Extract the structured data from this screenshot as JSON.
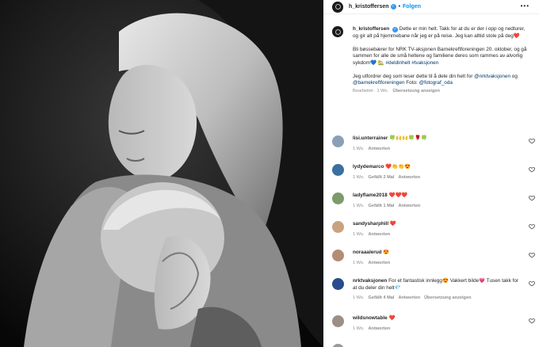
{
  "post": {
    "username": "h_kristoffersen",
    "dot": "•",
    "follow_label": "Folgen",
    "more_icon": "more-horizontal-icon"
  },
  "caption": {
    "username": "h_kristoffersen",
    "p1": "Dette er min helt. Takk for at du er der i opp og nedturer, og gir alt på hjemmebane når jeg er på reise. Jeg kan alltid stole på deg❤️",
    "p2_text": "Bli bøssebærer for NRK TV-aksjonen Barnekreftforeningen 20. oktober, og gå sammen for alle de små heltene og familiene deres som rammes av alvorlig sykdom💙 🏡 ",
    "p2_tag1": "#deldinhelt",
    "p2_tag2": "#tvaksjonen",
    "p3_text": "Jeg utfordrer deg som leser dette til å dele din helt for ",
    "p3_mention1": "@nrktvaksjonen",
    "p3_og": " og ",
    "p3_mention2": "@barnekreftforeningen",
    "p3_foto": " Foto: ",
    "p3_mention3": "@fotograf_oda",
    "meta_edited": "Bearbeitet · 1 Wo.",
    "meta_translation": "Übersetzung anzeigen"
  },
  "comments": [
    {
      "username": "lisi.unterrainer",
      "text": "🍀🙌🙌🍀🌹🍀",
      "time": "1 Wo.",
      "likes": "",
      "reply": "Antworten",
      "translation": "",
      "avatar_color": "#8aa0b8"
    },
    {
      "username": "lydydemarco",
      "text": "❤️👏👏😍",
      "time": "1 Wo.",
      "likes": "Gefällt 2 Mal",
      "reply": "Antworten",
      "translation": "",
      "avatar_color": "#3b6fa0"
    },
    {
      "username": "ladyflame2018",
      "text": "❤️❤️❤️",
      "time": "1 Wo.",
      "likes": "Gefällt 1 Mal",
      "reply": "Antworten",
      "translation": "",
      "avatar_color": "#7c9a6a"
    },
    {
      "username": "sandysharphill",
      "text": "❤️",
      "time": "1 Wo.",
      "likes": "",
      "reply": "Antworten",
      "translation": "",
      "avatar_color": "#c9a27e"
    },
    {
      "username": "noraaalerud",
      "text": "😍",
      "time": "1 Wo.",
      "likes": "",
      "reply": "Antworten",
      "translation": "",
      "avatar_color": "#b58b73"
    },
    {
      "username": "nrktvaksjonen",
      "text": "For et fantastisk innlegg😍 Vakkert bilde💗 Tusen takk for at du deler din helt💎",
      "time": "1 Wo.",
      "likes": "Gefällt 4 Mal",
      "reply": "Antworten",
      "translation": "Übersetzung anzeigen",
      "avatar_color": "#2a4b8d"
    },
    {
      "username": "wildsnowtable",
      "text": "❤️",
      "time": "1 Wo.",
      "likes": "",
      "reply": "Antworten",
      "translation": "",
      "avatar_color": "#9c8f86"
    }
  ],
  "colors": {
    "link_blue": "#0095f6",
    "mention_blue": "#00376b",
    "verified_blue": "#3897f0",
    "meta_gray": "#8e8e8e"
  }
}
